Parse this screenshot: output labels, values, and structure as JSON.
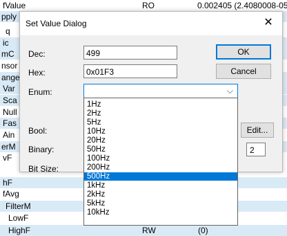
{
  "background": {
    "rows": [
      {
        "left": "fValue",
        "mid": "RO",
        "right": "0.002405 (2.4080008-05)"
      },
      {
        "left": "pply",
        "mid": "",
        "right": ""
      },
      {
        "left": "q",
        "mid": "",
        "right": ""
      },
      {
        "left": "ic",
        "mid": "",
        "right": ""
      },
      {
        "left": "mC",
        "mid": "",
        "right": ""
      },
      {
        "left": "nsor",
        "mid": "",
        "right": ""
      },
      {
        "left": "ange",
        "mid": "",
        "right": ""
      },
      {
        "left": "Var",
        "mid": "",
        "right": ""
      },
      {
        "left": "Sca",
        "mid": "",
        "right": ""
      },
      {
        "left": "Null",
        "mid": "",
        "right": ""
      },
      {
        "left": "Fas",
        "mid": "",
        "right": ""
      },
      {
        "left": "Ain",
        "mid": "",
        "right": ""
      },
      {
        "left": "erM",
        "mid": "",
        "right": ""
      },
      {
        "left": "vF",
        "mid": "",
        "right": ""
      },
      {
        "left": "hF",
        "mid": "",
        "right": ""
      },
      {
        "left": "fAvg",
        "mid": "",
        "right": ""
      },
      {
        "left": "FilterM",
        "mid": "",
        "right": ""
      },
      {
        "left": "LowF",
        "mid": "",
        "right": ""
      },
      {
        "left": "HighF",
        "mid": "RW",
        "right": "(0)"
      }
    ]
  },
  "dialog": {
    "title": "Set Value Dialog",
    "close_glyph": "✕",
    "dec_label": "Dec:",
    "dec_value": "499",
    "hex_label": "Hex:",
    "hex_value": "0x01F3",
    "enum_label": "Enum:",
    "enum_value": "",
    "enum_arrow": "⌵",
    "bool_label": "Bool:",
    "binary_label": "Binary:",
    "bitsize_label": "Bit Size:",
    "ok_label": "OK",
    "cancel_label": "Cancel",
    "edit_label": "Edit...",
    "small_value": "2"
  },
  "dropdown": {
    "options": [
      "1Hz",
      "2Hz",
      "5Hz",
      "10Hz",
      "20Hz",
      "50Hz",
      "100Hz",
      "200Hz",
      "500Hz",
      "1kHz",
      "2kHz",
      "5kHz",
      "10kHz"
    ],
    "selected_index": 8
  },
  "colors": {
    "accent": "#0078d7",
    "stripe": "#d9eaf7"
  }
}
